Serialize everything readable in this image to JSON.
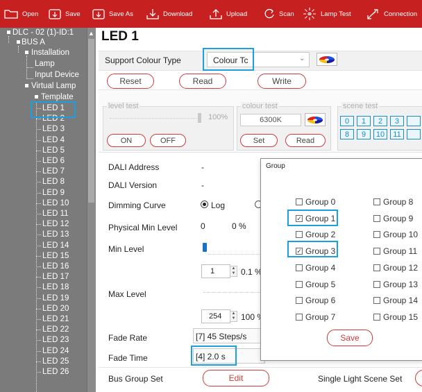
{
  "toolbar": {
    "open_label": "Open",
    "save_label": "Save",
    "save_as_label": "Save As",
    "download_label": "Download",
    "upload_label": "Upload",
    "scan_label": "Scan",
    "lamp_test_label": "Lamp Test",
    "connection_label": "Connection"
  },
  "tree": {
    "root": "DLC - 02 (1)-ID:1",
    "bus": "BUS A",
    "installation": "Installation",
    "lamp": "Lamp",
    "input_device": "Input Device",
    "virtual_lamp": "Virtual Lamp",
    "template": "Template",
    "leds": [
      "LED 1",
      "LED 2",
      "LED 3",
      "LED 4",
      "LED 5",
      "LED 6",
      "LED 7",
      "LED 8",
      "LED 9",
      "LED 10",
      "LED 11",
      "LED 12",
      "LED 13",
      "LED 14",
      "LED 15",
      "LED 16",
      "LED 17",
      "LED 18",
      "LED 19",
      "LED 20",
      "LED 21",
      "LED 22",
      "LED 23",
      "LED 24",
      "LED 25",
      "LED 26"
    ]
  },
  "page": {
    "title": "LED 1",
    "support_colour_type_label": "Support Colour Type",
    "colour_type_value": "Colour Tc",
    "reset_label": "Reset",
    "read_label": "Read",
    "write_label": "Write"
  },
  "level_test": {
    "legend": "level test",
    "percent": "100%",
    "on_label": "ON",
    "off_label": "OFF"
  },
  "colour_test": {
    "legend": "colour test",
    "value": "6300K",
    "set_label": "Set",
    "read_label": "Read"
  },
  "scene_test": {
    "legend": "scene test",
    "row1": [
      "0",
      "1",
      "2",
      "3"
    ],
    "row2": [
      "8",
      "9",
      "10",
      "11"
    ]
  },
  "fields": {
    "dali_address_label": "DALI Address",
    "dali_address_value": "-",
    "dali_version_label": "DALI Version",
    "dali_version_value": "-",
    "dimming_curve_label": "Dimming Curve",
    "dimming_curve_log": "Log",
    "physical_min_label": "Physical Min Level",
    "physical_min_value": "0",
    "physical_min_percent": "0 %",
    "min_level_label": "Min Level",
    "min_level_value": "1",
    "min_level_percent": "0.1 %",
    "max_level_label": "Max Level",
    "max_level_value": "254",
    "max_level_percent": "100 %",
    "fade_rate_label": "Fade Rate",
    "fade_rate_value": "[7] 45 Steps/s",
    "fade_time_label": "Fade Time",
    "fade_time_value": "[4] 2.0 s",
    "bus_group_set_label": "Bus Group Set",
    "edit_label": "Edit",
    "single_light_scene_set_label": "Single Light Scene Set"
  },
  "group_dialog": {
    "title": "Group",
    "groups": [
      {
        "label": "Group 0",
        "checked": false
      },
      {
        "label": "Group 1",
        "checked": true
      },
      {
        "label": "Group 2",
        "checked": false
      },
      {
        "label": "Group 3",
        "checked": true
      },
      {
        "label": "Group 4",
        "checked": false
      },
      {
        "label": "Group 5",
        "checked": false
      },
      {
        "label": "Group 6",
        "checked": false
      },
      {
        "label": "Group 7",
        "checked": false
      },
      {
        "label": "Group 8",
        "checked": false
      },
      {
        "label": "Group 9",
        "checked": false
      },
      {
        "label": "Group 10",
        "checked": false
      },
      {
        "label": "Group 11",
        "checked": false
      },
      {
        "label": "Group 12",
        "checked": false
      },
      {
        "label": "Group 13",
        "checked": false
      },
      {
        "label": "Group 14",
        "checked": false
      },
      {
        "label": "Group 15",
        "checked": false
      }
    ],
    "save_label": "Save"
  },
  "icons": {
    "toolbar": [
      "folder-icon",
      "save-icon",
      "save-as-icon",
      "download-icon",
      "upload-icon",
      "scan-icon",
      "lamp-icon",
      "connection-icon"
    ],
    "colour_picker": "color-wheel-icon"
  },
  "colors": {
    "toolbar": "#c62020",
    "sidebar": "#7b7b7b",
    "highlight": "#1a9fe0",
    "button_border": "#d03a3a",
    "scene_button": "#1b8cc6"
  }
}
